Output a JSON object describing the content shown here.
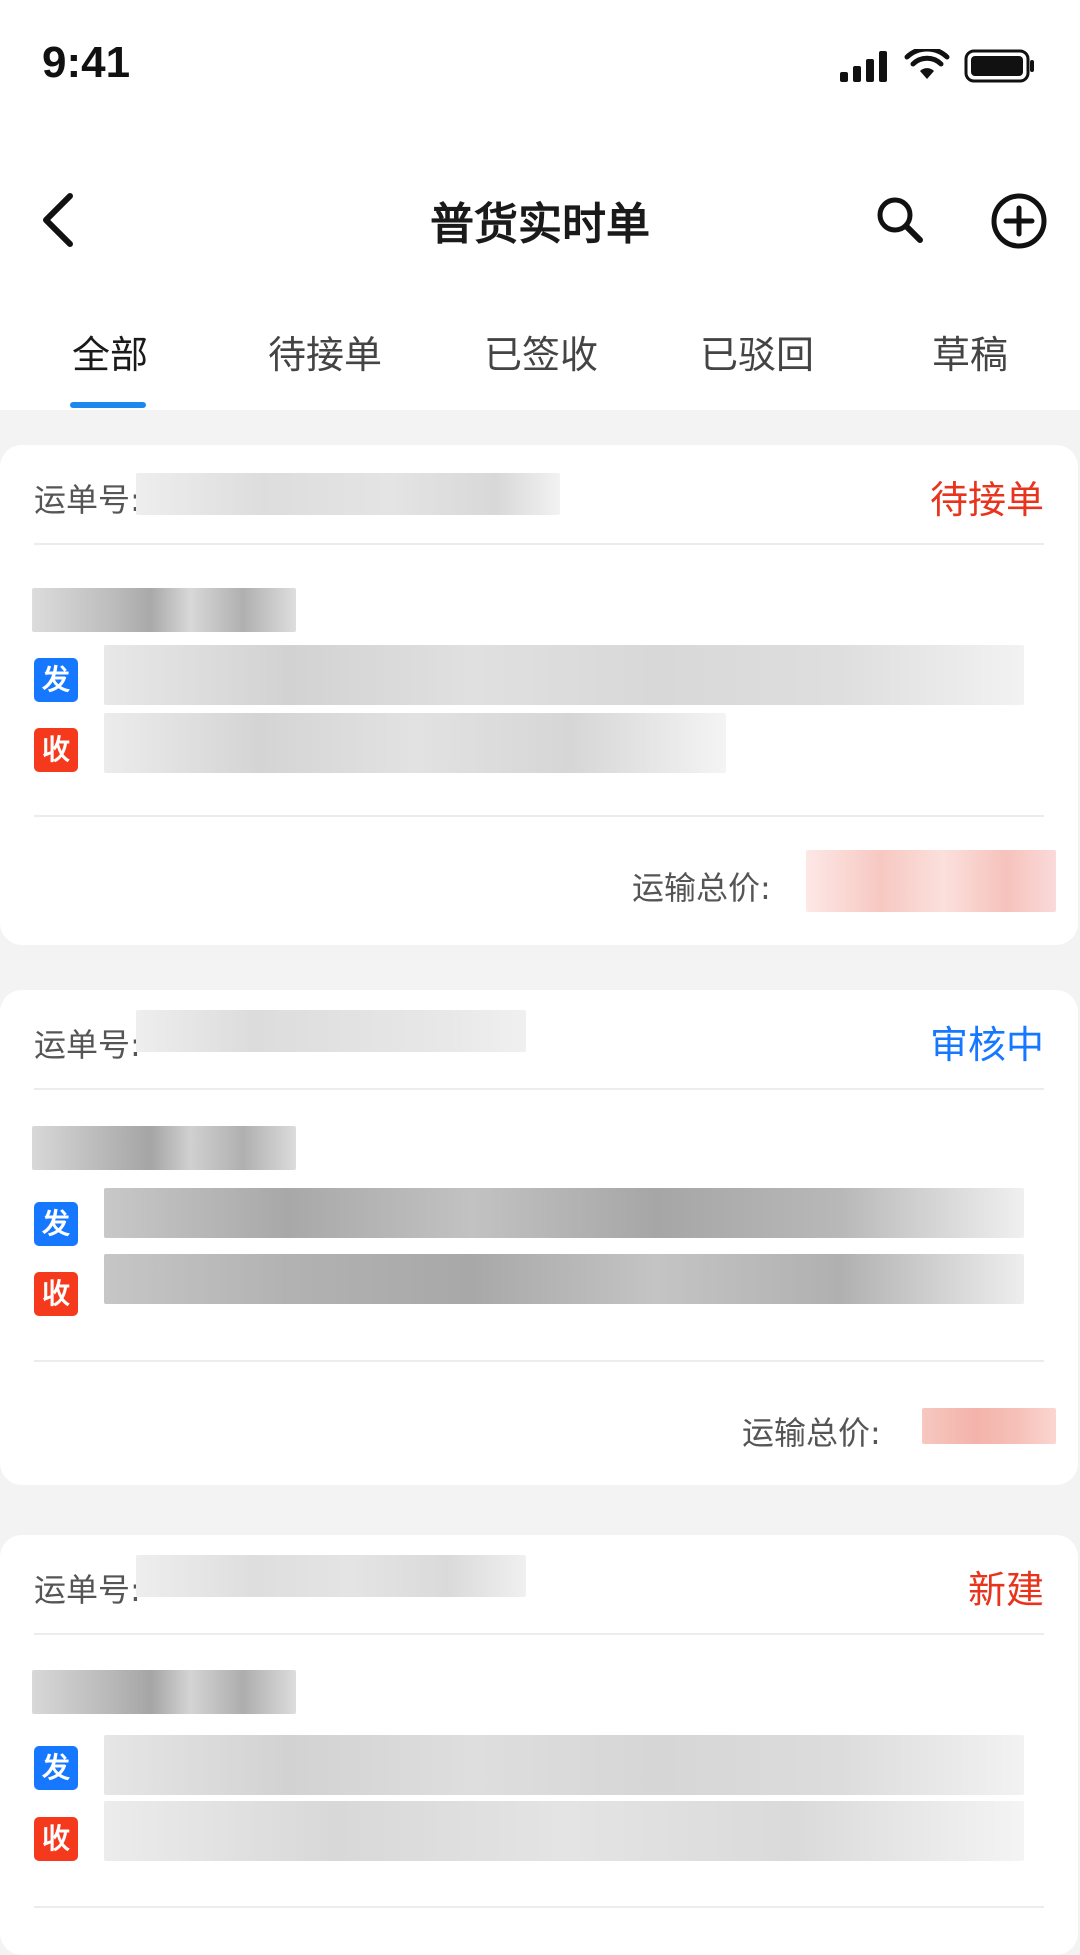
{
  "status_bar": {
    "time": "9:41",
    "icons": [
      "signal-icon",
      "wifi-icon",
      "battery-icon"
    ]
  },
  "nav": {
    "title": "普货实时单",
    "icons": [
      "back-arrow-icon",
      "search-icon",
      "add-circle-icon"
    ]
  },
  "tabs": [
    {
      "label": "全部"
    },
    {
      "label": "待接单"
    },
    {
      "label": "已签收"
    },
    {
      "label": "已驳回"
    },
    {
      "label": "草稿"
    }
  ],
  "colors": {
    "accent": "#1e88f0",
    "status_red": "#e8341c",
    "status_blue": "#1677ff",
    "send_tag": "#1677ff",
    "recv_tag": "#f5391c"
  },
  "orders": [
    {
      "waybill_label": "运单号:",
      "status": "待接单",
      "send_tag": "发",
      "recv_tag": "收",
      "price_label": "运输总价:"
    },
    {
      "waybill_label": "运单号:",
      "status": "审核中",
      "send_tag": "发",
      "recv_tag": "收",
      "price_label": "运输总价:"
    },
    {
      "waybill_label": "运单号:",
      "status": "新建",
      "send_tag": "发",
      "recv_tag": "收"
    }
  ]
}
